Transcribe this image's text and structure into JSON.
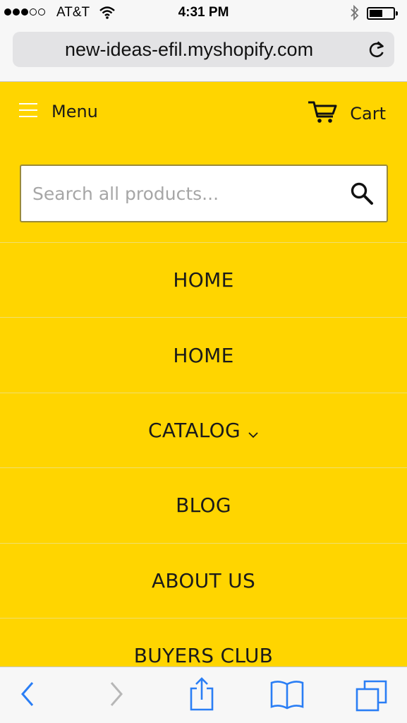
{
  "status": {
    "carrier": "AT&T",
    "time": "4:31 PM",
    "signal_bars_filled": 3,
    "signal_bars_total": 5
  },
  "browser": {
    "url": "new-ideas-efil.myshopify.com"
  },
  "header": {
    "menu_label": "Menu",
    "cart_label": "Cart"
  },
  "search": {
    "placeholder": "Search all products..."
  },
  "nav": {
    "items": [
      {
        "label": "HOME"
      },
      {
        "label": "HOME"
      },
      {
        "label": "CATALOG"
      },
      {
        "label": "BLOG"
      },
      {
        "label": "ABOUT US"
      },
      {
        "label": "BUYERS CLUB"
      }
    ]
  },
  "colors": {
    "page_background": "#ffd500",
    "toolbar_icon": "#2a7ef5",
    "toolbar_icon_disabled": "#b7b7b7"
  },
  "icons": [
    "wifi-icon",
    "bluetooth-icon",
    "battery-icon",
    "reload-icon",
    "hamburger-icon",
    "cart-icon",
    "search-icon",
    "chevron-down-icon",
    "back-icon",
    "forward-icon",
    "share-icon",
    "bookmarks-icon",
    "tabs-icon"
  ]
}
